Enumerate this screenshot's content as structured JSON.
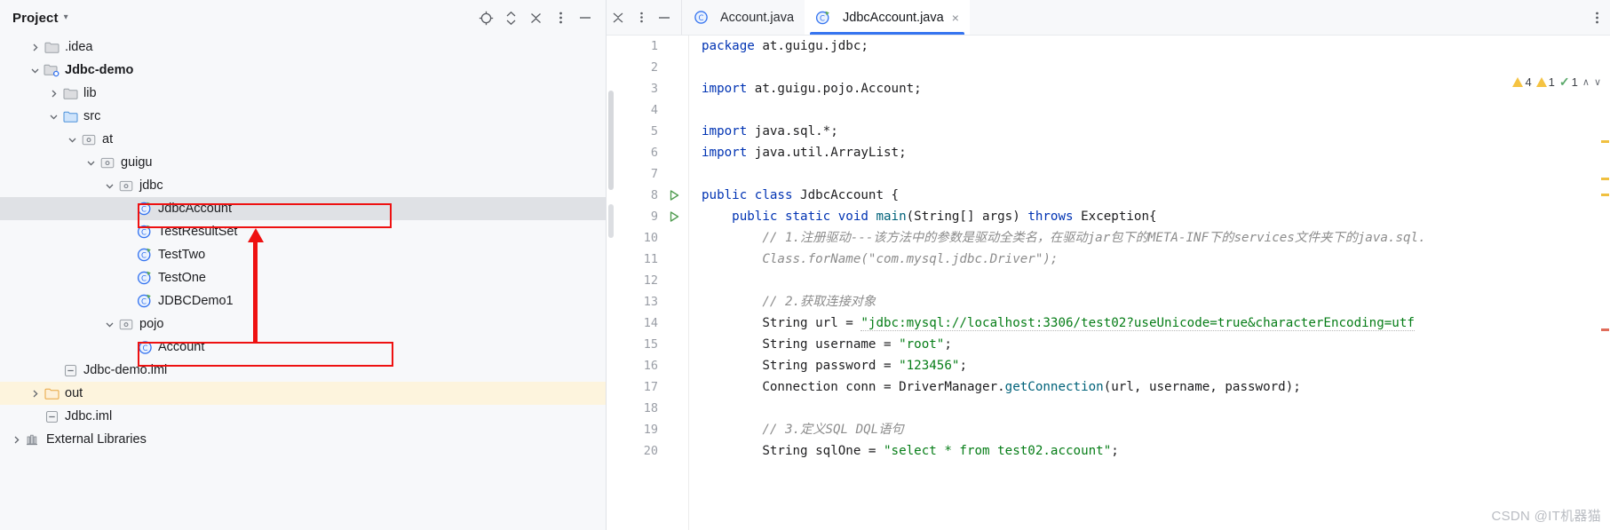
{
  "project_panel": {
    "title": "Project",
    "header_icons": [
      "locate-target-icon",
      "expand-collapse-icon",
      "collapse-all-icon",
      "more-options-icon",
      "minimize-icon"
    ],
    "tree": [
      {
        "label": ".idea",
        "indent": 1,
        "arrow": "right",
        "icon": "folder-icon",
        "state": "normal"
      },
      {
        "label": "Jdbc-demo",
        "indent": 1,
        "arrow": "down",
        "icon": "module-folder-icon",
        "state": "normal",
        "bold": true
      },
      {
        "label": "lib",
        "indent": 2,
        "arrow": "right",
        "icon": "folder-icon",
        "state": "normal"
      },
      {
        "label": "src",
        "indent": 2,
        "arrow": "down",
        "icon": "source-folder-icon",
        "state": "normal"
      },
      {
        "label": "at",
        "indent": 3,
        "arrow": "down",
        "icon": "package-icon",
        "state": "normal"
      },
      {
        "label": "guigu",
        "indent": 4,
        "arrow": "down",
        "icon": "package-icon",
        "state": "normal"
      },
      {
        "label": "jdbc",
        "indent": 5,
        "arrow": "down",
        "icon": "package-icon",
        "state": "normal"
      },
      {
        "label": "JdbcAccount",
        "indent": 6,
        "arrow": "none",
        "icon": "runnable-class-icon",
        "state": "selected"
      },
      {
        "label": "TestResultSet",
        "indent": 6,
        "arrow": "none",
        "icon": "runnable-class-icon",
        "state": "normal"
      },
      {
        "label": "TestTwo",
        "indent": 6,
        "arrow": "none",
        "icon": "runnable-class-icon",
        "state": "normal"
      },
      {
        "label": "TestOne",
        "indent": 6,
        "arrow": "none",
        "icon": "runnable-class-icon",
        "state": "normal"
      },
      {
        "label": "JDBCDemo1",
        "indent": 6,
        "arrow": "none",
        "icon": "runnable-class-icon",
        "state": "normal"
      },
      {
        "label": "pojo",
        "indent": 5,
        "arrow": "down",
        "icon": "package-icon",
        "state": "normal"
      },
      {
        "label": "Account",
        "indent": 6,
        "arrow": "none",
        "icon": "class-icon",
        "state": "normal"
      },
      {
        "label": "Jdbc-demo.iml",
        "indent": 2,
        "arrow": "none",
        "icon": "iml-file-icon",
        "state": "normal"
      },
      {
        "label": "out",
        "indent": 1,
        "arrow": "right",
        "icon": "excluded-folder-icon",
        "state": "highlight"
      },
      {
        "label": "Jdbc.iml",
        "indent": 1,
        "arrow": "none",
        "icon": "iml-file-icon",
        "state": "normal"
      },
      {
        "label": "External Libraries",
        "indent": 0,
        "arrow": "right",
        "icon": "libraries-icon",
        "state": "normal"
      }
    ],
    "annotations": {
      "box1_target": "JdbcAccount",
      "box2_target": "Account",
      "arrow_color": "#ee1111",
      "arrow_direction": "up"
    }
  },
  "editor": {
    "tabs": [
      {
        "label": "Account.java",
        "icon": "class-icon",
        "active": false,
        "closable": false
      },
      {
        "label": "JdbcAccount.java",
        "icon": "runnable-class-icon",
        "active": true,
        "closable": true
      }
    ],
    "tab_close_glyph": "×",
    "more_menu_glyph": "⋮",
    "window_buttons": [
      "collapse-icon",
      "more-icon",
      "minimize-icon"
    ],
    "inspections": {
      "warning_count": "4",
      "weak_warning_count": "1",
      "ok_count": "1",
      "caret_up": "∧",
      "caret_down": "∨"
    },
    "accent_color": "#3574f0",
    "lines": [
      {
        "n": "1",
        "runnable": false,
        "tokens": [
          {
            "t": "package ",
            "c": "kw"
          },
          {
            "t": "at.guigu.jdbc;",
            "c": "plain"
          }
        ]
      },
      {
        "n": "2",
        "runnable": false,
        "tokens": []
      },
      {
        "n": "3",
        "runnable": false,
        "tokens": [
          {
            "t": "import ",
            "c": "kw"
          },
          {
            "t": "at.guigu.pojo.Account;",
            "c": "plain"
          }
        ]
      },
      {
        "n": "4",
        "runnable": false,
        "tokens": []
      },
      {
        "n": "5",
        "runnable": false,
        "tokens": [
          {
            "t": "import ",
            "c": "kw"
          },
          {
            "t": "java.sql.*;",
            "c": "plain"
          }
        ]
      },
      {
        "n": "6",
        "runnable": false,
        "tokens": [
          {
            "t": "import ",
            "c": "kw"
          },
          {
            "t": "java.util.ArrayList;",
            "c": "plain"
          }
        ]
      },
      {
        "n": "7",
        "runnable": false,
        "tokens": []
      },
      {
        "n": "8",
        "runnable": true,
        "tokens": [
          {
            "t": "public class ",
            "c": "kw"
          },
          {
            "t": "JdbcAccount ",
            "c": "cls"
          },
          {
            "t": "{",
            "c": "plain"
          }
        ]
      },
      {
        "n": "9",
        "runnable": true,
        "tokens": [
          {
            "t": "    ",
            "c": "plain"
          },
          {
            "t": "public static void ",
            "c": "kw"
          },
          {
            "t": "main",
            "c": "mth"
          },
          {
            "t": "(String[] args) ",
            "c": "plain"
          },
          {
            "t": "throws ",
            "c": "kw"
          },
          {
            "t": "Exception{",
            "c": "plain"
          }
        ]
      },
      {
        "n": "10",
        "runnable": false,
        "tokens": [
          {
            "t": "        // 1.注册驱动---该方法中的参数是驱动全类名，在驱动jar包下的META-INF下的services文件夹下的java.sql.",
            "c": "cmt"
          }
        ]
      },
      {
        "n": "11",
        "runnable": false,
        "commented_out": "//",
        "tokens": [
          {
            "t": "        Class.forName(\"com.mysql.jdbc.Driver\");",
            "c": "cmt"
          }
        ]
      },
      {
        "n": "12",
        "runnable": false,
        "tokens": []
      },
      {
        "n": "13",
        "runnable": false,
        "tokens": [
          {
            "t": "        // 2.获取连接对象",
            "c": "cmt"
          }
        ]
      },
      {
        "n": "14",
        "runnable": false,
        "tokens": [
          {
            "t": "        String url = ",
            "c": "plain"
          },
          {
            "t": "\"jdbc:mysql://localhost:3306/test02?useUnicode=true&characterEncoding=utf",
            "c": "str"
          }
        ]
      },
      {
        "n": "15",
        "runnable": false,
        "tokens": [
          {
            "t": "        String username = ",
            "c": "plain"
          },
          {
            "t": "\"root\"",
            "c": "str"
          },
          {
            "t": ";",
            "c": "plain"
          }
        ]
      },
      {
        "n": "16",
        "runnable": false,
        "tokens": [
          {
            "t": "        String password = ",
            "c": "plain"
          },
          {
            "t": "\"123456\"",
            "c": "str"
          },
          {
            "t": ";",
            "c": "plain"
          }
        ]
      },
      {
        "n": "17",
        "runnable": false,
        "tokens": [
          {
            "t": "        Connection conn = DriverManager.",
            "c": "plain"
          },
          {
            "t": "getConnection",
            "c": "mth"
          },
          {
            "t": "(url, username, password);",
            "c": "plain"
          }
        ]
      },
      {
        "n": "18",
        "runnable": false,
        "tokens": []
      },
      {
        "n": "19",
        "runnable": false,
        "tokens": [
          {
            "t": "        // 3.定义SQL DQL语句",
            "c": "cmt"
          }
        ]
      },
      {
        "n": "20",
        "runnable": false,
        "tokens": [
          {
            "t": "        String sqlOne = ",
            "c": "plain"
          },
          {
            "t": "\"select * from test02.account\"",
            "c": "str"
          },
          {
            "t": ";",
            "c": "plain"
          }
        ]
      }
    ]
  },
  "watermark": "CSDN @IT机器猫"
}
